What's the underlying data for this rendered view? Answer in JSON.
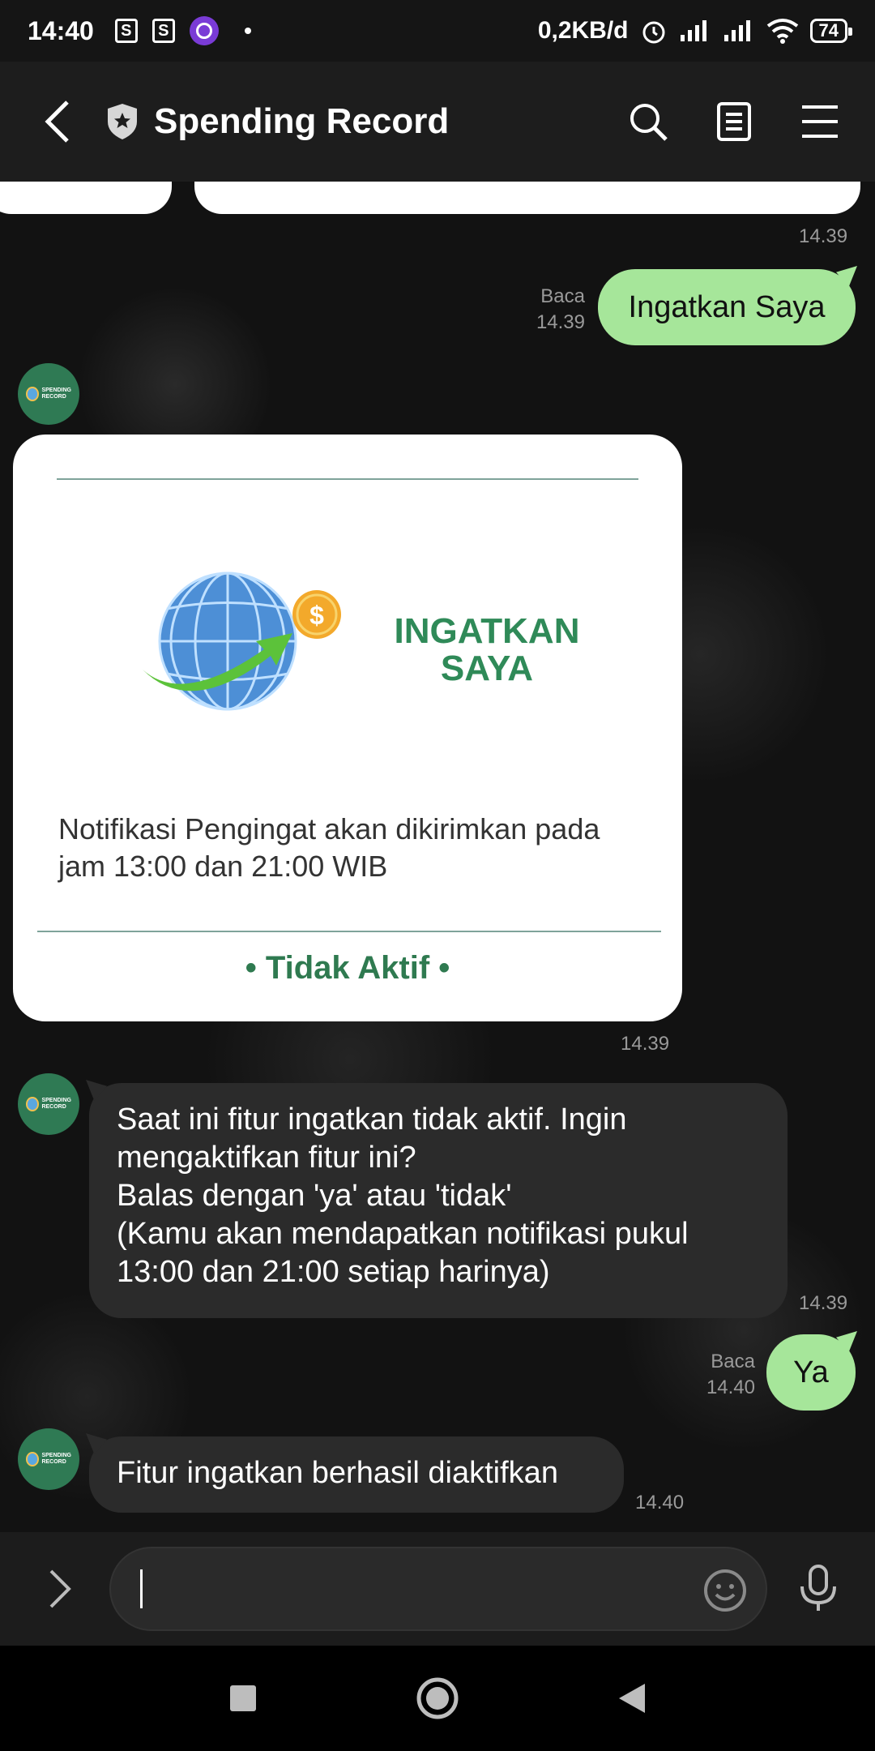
{
  "status_bar": {
    "time": "14:40",
    "network_speed": "0,2KB/d",
    "battery": "74"
  },
  "header": {
    "title": "Spending Record",
    "back_icon": "chevron-left-icon",
    "shield_icon": "shield-star-icon",
    "search_icon": "search-icon",
    "notes_icon": "notes-icon",
    "menu_icon": "hamburger-menu-icon"
  },
  "messages": {
    "ts_top": "14.39",
    "out1": {
      "text": "Ingatkan Saya",
      "read": "Baca",
      "time": "14.39"
    },
    "card": {
      "banner_title": "INGATKAN SAYA",
      "description": "Notifikasi Pengingat akan dikirimkan pada jam 13:00 dan 21:00 WIB",
      "status": "• Tidak Aktif •",
      "time": "14.39"
    },
    "in1": {
      "line1": "Saat ini fitur ingatkan tidak aktif. Ingin",
      "line2": "mengaktifkan fitur ini?",
      "line3": "Balas dengan 'ya' atau 'tidak'",
      "line4": "(Kamu akan mendapatkan notifikasi pukul",
      "line5": "13:00 dan 21:00 setiap harinya)",
      "time": "14.39"
    },
    "out2": {
      "text": "Ya",
      "read": "Baca",
      "time": "14.40"
    },
    "in2": {
      "text": "Fitur ingatkan berhasil diaktifkan",
      "time": "14.40"
    }
  },
  "input": {
    "value": "",
    "placeholder": ""
  },
  "colors": {
    "outgoing_bubble": "#a6e69a",
    "incoming_bubble": "#2b2b2b",
    "accent_green": "#2f7a50"
  }
}
